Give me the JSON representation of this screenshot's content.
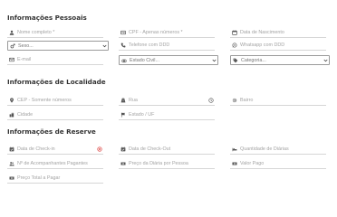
{
  "sections": {
    "personal": "Informações Pessoais",
    "location": "Informações de Localidade",
    "booking": "Informações de Reserve"
  },
  "personal": {
    "full_name": "Nome completo *",
    "cpf": "CPF - Apenas números *",
    "birth_date": "Data de Nascimento",
    "sex": "Sexo...",
    "phone": "Telefone com DDD",
    "whatsapp": "Whatsapp com DDD",
    "email": "E-mail",
    "marital_status": "Estado Civil...",
    "category": "Categoria..."
  },
  "location": {
    "cep": "CEP - Somente números",
    "street": "Rua",
    "neighborhood": "Bairro",
    "city": "Cidade",
    "state": "Estado / UF"
  },
  "booking": {
    "checkin": "Data de Check-in",
    "checkout": "Data de Check-Out",
    "daily_count": "Quantidade de Diárias",
    "companions": "Nº de Acompanhantes Pagantes",
    "price_per_person": "Preço da Diária por Pessoa",
    "amount_paid": "Valor Pago",
    "total_price": "Preço Total a Pagar"
  },
  "colors": {
    "error_icon": "#e0524f",
    "icon": "#555555"
  }
}
